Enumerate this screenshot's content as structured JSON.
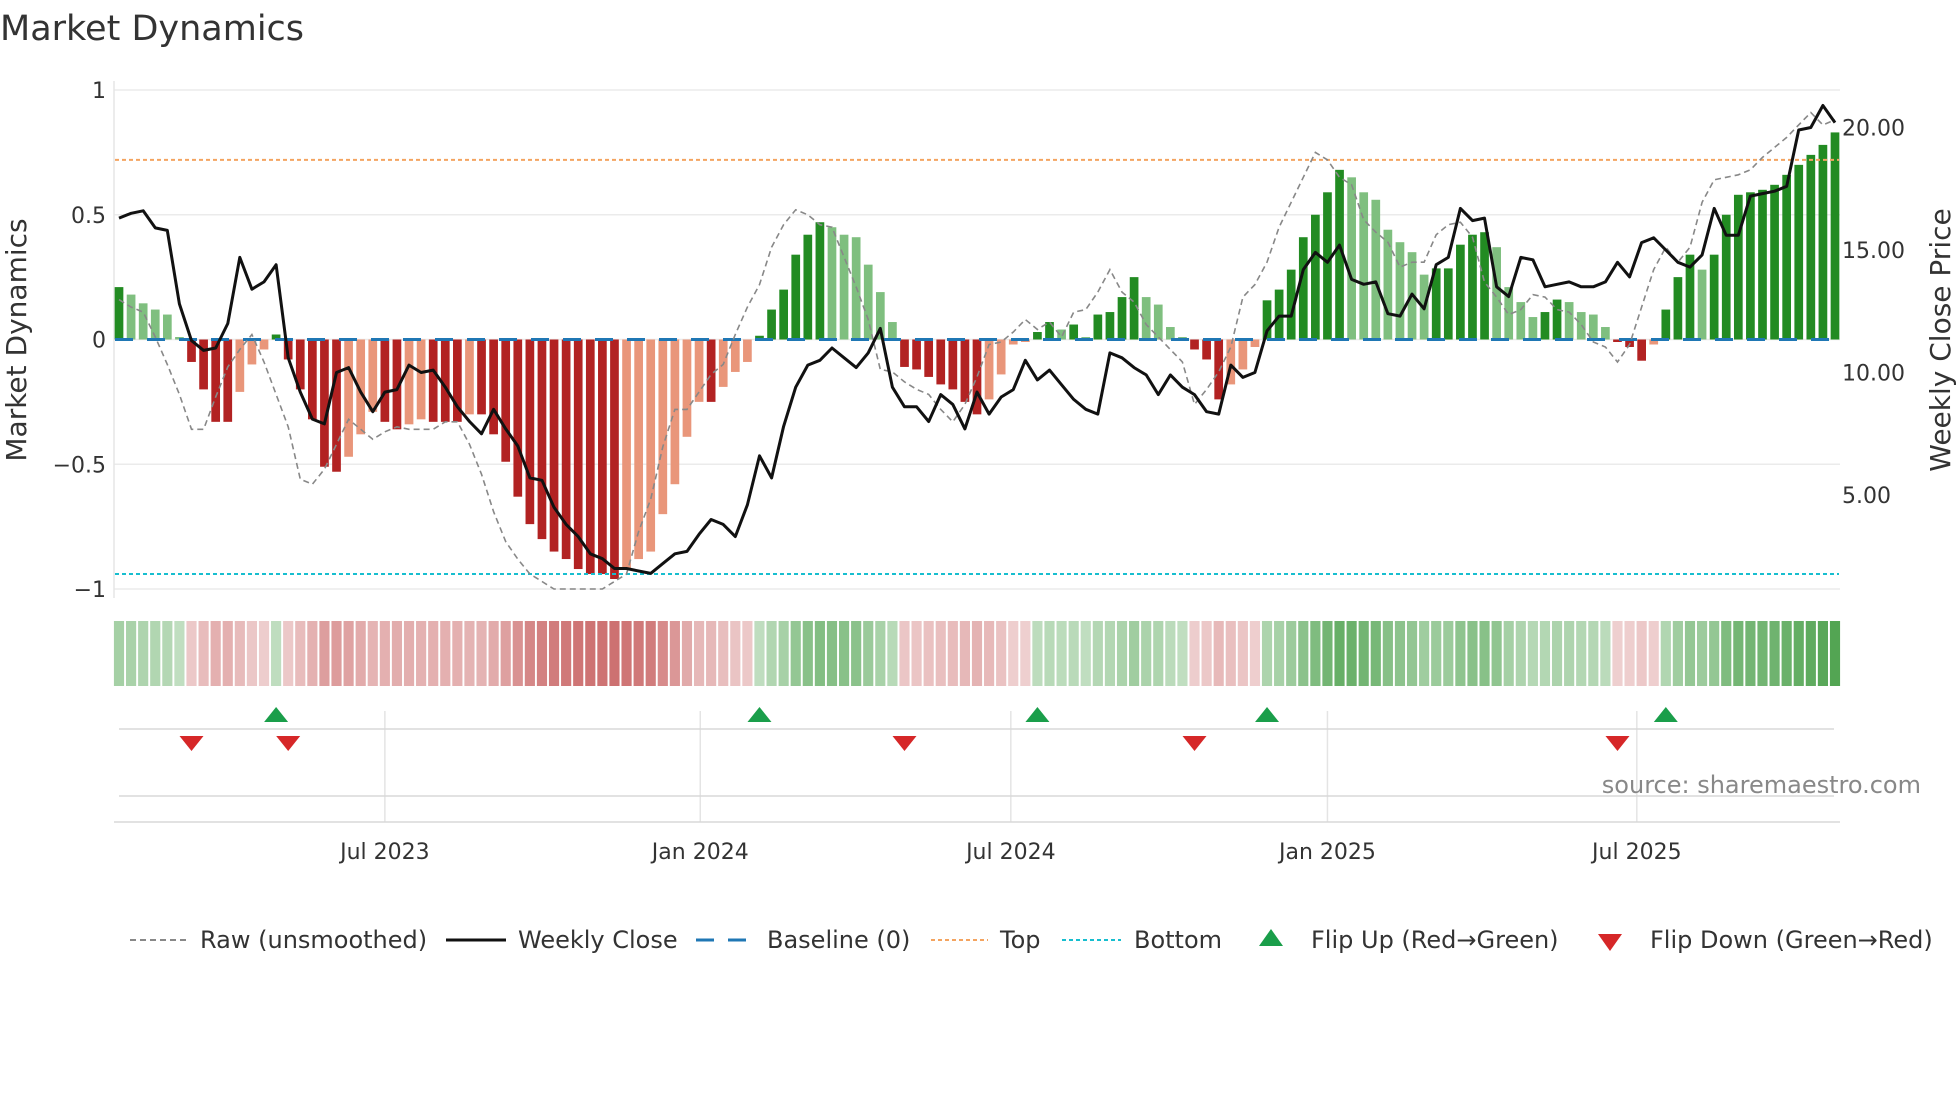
{
  "title": "Market Dynamics",
  "source": "source: sharemaestro.com",
  "colors": {
    "pos_rising": "#228b22",
    "pos_falling": "#7fbf7f",
    "neg_falling": "#b22222",
    "neg_rising": "#e9967a",
    "baseline": "#1f77b4",
    "top": "#f4a460",
    "bottom": "#17becf",
    "flip_up": "#1a9e4a",
    "flip_down": "#d62728",
    "raw": "#888888",
    "close": "#111111"
  },
  "chart_data": {
    "type": "bar",
    "title": "Market Dynamics",
    "ylabel": "Market Dynamics",
    "y2label": "Weekly Close Price",
    "ylim": [
      -1,
      1
    ],
    "y2lim": [
      0,
      21.5
    ],
    "yticks": [
      {
        "v": 1,
        "label": "1"
      },
      {
        "v": 0.5,
        "label": "0.5"
      },
      {
        "v": 0,
        "label": "0"
      },
      {
        "v": -0.5,
        "label": "−0.5"
      },
      {
        "v": -1,
        "label": "−1"
      }
    ],
    "y2ticks": [
      {
        "v": 20,
        "label": "20.00"
      },
      {
        "v": 15,
        "label": "15.00"
      },
      {
        "v": 10,
        "label": "10.00"
      },
      {
        "v": 5,
        "label": "5.00"
      }
    ],
    "xticks": [
      {
        "week": 22,
        "label": "Jul 2023"
      },
      {
        "week": 48.1,
        "label": "Jan 2024"
      },
      {
        "week": 73.8,
        "label": "Jul 2024"
      },
      {
        "week": 100,
        "label": "Jan 2025"
      },
      {
        "week": 125.6,
        "label": "Jul 2025"
      }
    ],
    "baseline": 0,
    "top": 0.72,
    "bottom": -0.94,
    "momentum": [
      0.21,
      0.18,
      0.145,
      0.12,
      0.1,
      0.01,
      -0.09,
      -0.2,
      -0.33,
      -0.33,
      -0.21,
      -0.1,
      -0.04,
      0.02,
      -0.08,
      -0.2,
      -0.32,
      -0.51,
      -0.53,
      -0.47,
      -0.38,
      -0.29,
      -0.33,
      -0.36,
      -0.34,
      -0.32,
      -0.33,
      -0.33,
      -0.33,
      -0.3,
      -0.3,
      -0.38,
      -0.49,
      -0.63,
      -0.74,
      -0.8,
      -0.85,
      -0.88,
      -0.92,
      -0.94,
      -0.94,
      -0.96,
      -0.92,
      -0.88,
      -0.85,
      -0.7,
      -0.58,
      -0.39,
      -0.25,
      -0.25,
      -0.19,
      -0.13,
      -0.09,
      0.015,
      0.12,
      0.2,
      0.34,
      0.42,
      0.47,
      0.45,
      0.42,
      0.41,
      0.3,
      0.19,
      0.07,
      -0.11,
      -0.12,
      -0.15,
      -0.18,
      -0.2,
      -0.25,
      -0.3,
      -0.24,
      -0.14,
      -0.02,
      -0.01,
      0.03,
      0.07,
      0.04,
      0.06,
      0.01,
      0.1,
      0.11,
      0.17,
      0.25,
      0.17,
      0.14,
      0.05,
      0.01,
      -0.04,
      -0.08,
      -0.24,
      -0.18,
      -0.12,
      -0.03,
      0.157,
      0.2,
      0.28,
      0.41,
      0.5,
      0.59,
      0.68,
      0.65,
      0.59,
      0.56,
      0.44,
      0.39,
      0.35,
      0.26,
      0.285,
      0.285,
      0.38,
      0.42,
      0.43,
      0.37,
      0.21,
      0.15,
      0.09,
      0.11,
      0.16,
      0.15,
      0.11,
      0.1,
      0.05,
      -0.01,
      -0.03,
      -0.085,
      -0.02,
      0.12,
      0.25,
      0.34,
      0.28,
      0.34,
      0.5,
      0.58,
      0.59,
      0.6,
      0.62,
      0.66,
      0.7,
      0.74,
      0.78,
      0.83
    ],
    "raw": [
      0.16,
      0.13,
      0.11,
      0.01,
      -0.1,
      -0.22,
      -0.36,
      -0.36,
      -0.23,
      -0.11,
      -0.04,
      0.02,
      -0.09,
      -0.22,
      -0.35,
      -0.56,
      -0.58,
      -0.52,
      -0.42,
      -0.32,
      -0.36,
      -0.4,
      -0.37,
      -0.35,
      -0.36,
      -0.36,
      -0.36,
      -0.33,
      -0.33,
      -0.42,
      -0.54,
      -0.69,
      -0.81,
      -0.88,
      -0.94,
      -0.97,
      -1.0,
      -1.0,
      -1.0,
      -1.0,
      -1.0,
      -0.97,
      -0.94,
      -0.77,
      -0.64,
      -0.43,
      -0.28,
      -0.28,
      -0.21,
      -0.14,
      -0.1,
      0.02,
      0.13,
      0.22,
      0.37,
      0.46,
      0.52,
      0.5,
      0.46,
      0.45,
      0.33,
      0.21,
      0.08,
      -0.12,
      -0.13,
      -0.17,
      -0.2,
      -0.22,
      -0.28,
      -0.33,
      -0.26,
      -0.15,
      -0.02,
      -0.01,
      0.03,
      0.08,
      0.04,
      0.07,
      0.01,
      0.11,
      0.12,
      0.19,
      0.28,
      0.19,
      0.15,
      0.06,
      0.01,
      -0.04,
      -0.09,
      -0.26,
      -0.2,
      -0.13,
      -0.03,
      0.17,
      0.22,
      0.31,
      0.45,
      0.55,
      0.65,
      0.75,
      0.72,
      0.65,
      0.62,
      0.48,
      0.43,
      0.39,
      0.29,
      0.31,
      0.31,
      0.42,
      0.46,
      0.47,
      0.41,
      0.23,
      0.17,
      0.1,
      0.12,
      0.18,
      0.17,
      0.12,
      0.11,
      0.06,
      -0.01,
      -0.03,
      -0.09,
      -0.02,
      0.13,
      0.28,
      0.37,
      0.31,
      0.37,
      0.55,
      0.64,
      0.65,
      0.66,
      0.68,
      0.73,
      0.77,
      0.81,
      0.86,
      0.91,
      0.86,
      0.88
    ],
    "close": [
      16.3,
      16.5,
      16.6,
      15.9,
      15.8,
      12.8,
      11.3,
      10.9,
      11.0,
      12.0,
      14.7,
      13.4,
      13.7,
      14.4,
      10.6,
      9.2,
      8.1,
      7.9,
      10.0,
      10.2,
      9.2,
      8.4,
      9.2,
      9.3,
      10.3,
      10.0,
      10.1,
      9.4,
      8.6,
      8.0,
      7.5,
      8.5,
      7.7,
      7.0,
      5.7,
      5.6,
      4.5,
      3.8,
      3.3,
      2.6,
      2.4,
      2.0,
      2.0,
      1.9,
      1.8,
      2.2,
      2.6,
      2.7,
      3.4,
      4.0,
      3.8,
      3.3,
      4.6,
      6.6,
      5.7,
      7.8,
      9.4,
      10.3,
      10.5,
      11.0,
      10.6,
      10.2,
      10.8,
      11.8,
      9.4,
      8.6,
      8.6,
      8.0,
      9.1,
      8.7,
      7.7,
      9.2,
      8.3,
      9.0,
      9.3,
      10.5,
      9.7,
      10.1,
      9.5,
      8.9,
      8.5,
      8.3,
      10.8,
      10.6,
      10.2,
      9.9,
      9.1,
      9.9,
      9.4,
      9.1,
      8.4,
      8.3,
      10.3,
      9.8,
      10.0,
      11.7,
      12.3,
      12.3,
      14.2,
      14.9,
      14.5,
      15.2,
      13.8,
      13.6,
      13.7,
      12.4,
      12.3,
      13.2,
      12.6,
      14.4,
      14.7,
      16.7,
      16.2,
      16.3,
      13.5,
      13.1,
      14.7,
      14.6,
      13.5,
      13.6,
      13.7,
      13.5,
      13.5,
      13.7,
      14.5,
      13.9,
      15.3,
      15.5,
      15.0,
      14.5,
      14.3,
      14.8,
      16.7,
      15.6,
      15.6,
      17.2,
      17.3,
      17.4,
      17.6,
      19.9,
      20.0,
      20.9,
      20.2
    ],
    "flip_up_weeks": [
      13,
      53,
      76,
      95,
      128
    ],
    "flip_down_weeks": [
      6,
      14,
      65,
      89,
      124
    ],
    "legend": {
      "placement": "bottom",
      "raw": "Raw (unsmoothed)",
      "close": "Weekly Close",
      "baseline": "Baseline (0)",
      "top": "Top",
      "bottom": "Bottom",
      "flip_up": "Flip Up (Red→Green)",
      "flip_down": "Flip Down (Green→Red)"
    }
  }
}
